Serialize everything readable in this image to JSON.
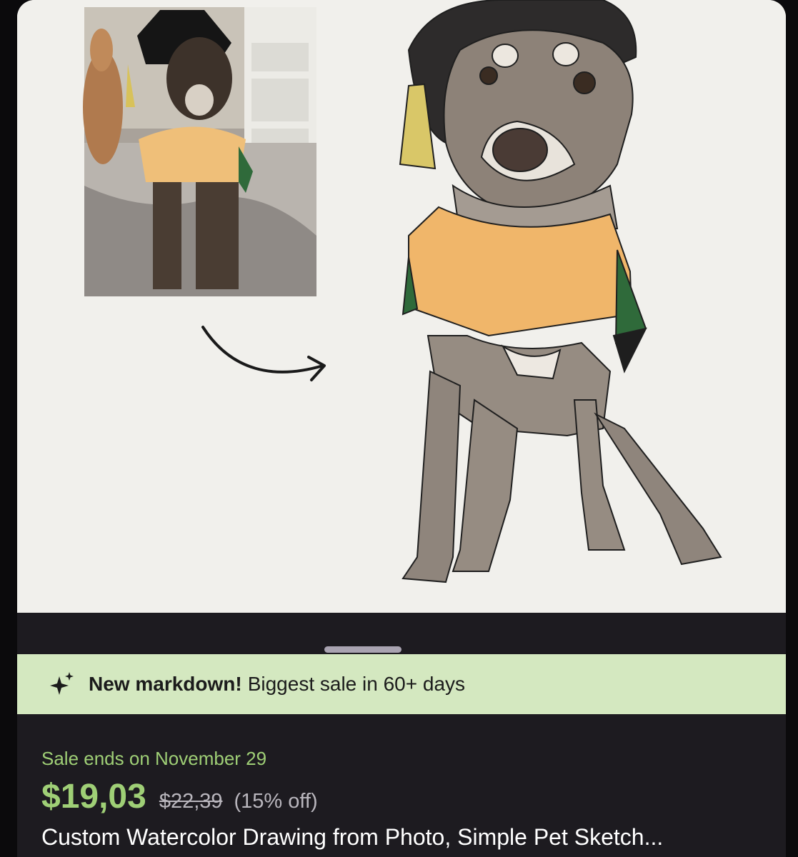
{
  "banner": {
    "icon": "sparkle-icon",
    "bold_text": "New markdown!",
    "text": "Biggest sale in 60+ days"
  },
  "sale": {
    "ends_text": "Sale ends on November 29",
    "current_price": "$19,03",
    "original_price": "$22,39",
    "discount": "(15% off)"
  },
  "listing": {
    "title": "Custom Watercolor Drawing from Photo, Simple Pet Sketch..."
  },
  "colors": {
    "background": "#0b0a0c",
    "sheet": "#1d1b20",
    "banner": "#d4e8c0",
    "price_accent": "#9fcf76"
  }
}
